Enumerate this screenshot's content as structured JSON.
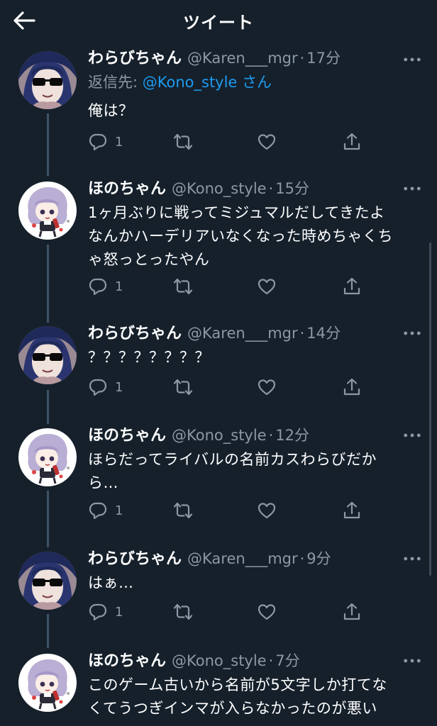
{
  "header": {
    "title": "ツイート",
    "back_icon": "arrow-left-icon"
  },
  "colors": {
    "background": "#15202b",
    "secondary_text": "#8b98a5",
    "link": "#1d9bf0",
    "thread_line": "#3d5466"
  },
  "tweets": [
    {
      "author": "わらびちゃん",
      "handle": "@Karen___mgr",
      "dot": "·",
      "time": "17分",
      "reply_prefix": "返信先: ",
      "reply_to": "@Kono_style",
      "reply_suffix": " さん",
      "text": "俺は？",
      "reply_count": "1",
      "avatar": "sunglasses-avatar"
    },
    {
      "author": "ほのちゃん",
      "handle": "@Kono_style",
      "dot": "·",
      "time": "15分",
      "text": "1ヶ月ぶりに戦ってミジュマルだしてきたよ\nなんかハーデリアいなくなった時めちゃくち\nゃ怒っとったやん",
      "reply_count": "1",
      "avatar": "chibi-avatar"
    },
    {
      "author": "わらびちゃん",
      "handle": "@Karen___mgr",
      "dot": "·",
      "time": "14分",
      "text": "？？？？？？？？",
      "reply_count": "1",
      "avatar": "sunglasses-avatar"
    },
    {
      "author": "ほのちゃん",
      "handle": "@Kono_style",
      "dot": "·",
      "time": "12分",
      "text": "ほらだってライバルの名前カスわらびだか\nら…",
      "reply_count": "1",
      "avatar": "chibi-avatar"
    },
    {
      "author": "わらびちゃん",
      "handle": "@Karen___mgr",
      "dot": "·",
      "time": "9分",
      "text": "はぁ…",
      "reply_count": "1",
      "avatar": "sunglasses-avatar"
    },
    {
      "author": "ほのちゃん",
      "handle": "@Kono_style",
      "dot": "·",
      "time": "7分",
      "text": "このゲーム古いから名前が5文字しか打てな\nくてうつぎインマが入らなかったのが悪い",
      "avatar": "chibi-avatar"
    }
  ]
}
